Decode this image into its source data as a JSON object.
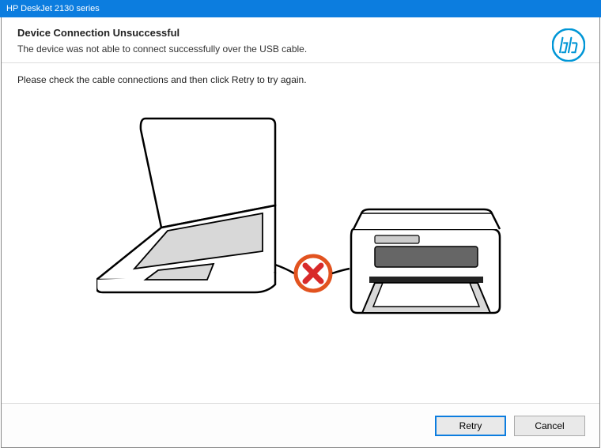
{
  "window": {
    "title": "HP DeskJet 2130 series"
  },
  "header": {
    "title": "Device Connection Unsuccessful",
    "subtitle": "The device was not able to connect successfully over the USB cable."
  },
  "content": {
    "instruction": "Please check the cable connections and then click Retry to try again."
  },
  "footer": {
    "retry_label": "Retry",
    "cancel_label": "Cancel"
  },
  "icons": {
    "hp_logo": "hp-logo",
    "laptop": "laptop-icon",
    "printer": "printer-icon",
    "error": "error-x-icon"
  },
  "colors": {
    "titlebar_bg": "#0c7ddf",
    "hp_blue": "#0096D6",
    "error_orange": "#e2531f",
    "error_red": "#d82a2a"
  }
}
